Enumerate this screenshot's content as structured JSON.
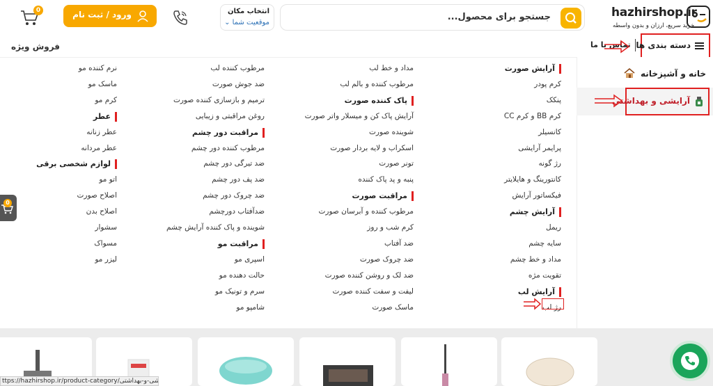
{
  "header": {
    "logo_main": "hazhirshop.ir",
    "logo_tagline": "خرید سریع، ارزان و بدون واسطه",
    "search_placeholder": "جستجو برای محصول...",
    "location_title": "انتخاب مکان",
    "location_value": "موقعیت شما",
    "login_label": "ورود / ثبت نام",
    "cart_count": "0"
  },
  "nav": {
    "categories_label": "دسته بندی ها",
    "contact_label": "تماس با ما",
    "special_sale_label": "فروش ویژه"
  },
  "categories": [
    {
      "label": "خانه و آشپزخانه"
    },
    {
      "label": "آرایشی و بهداشتی"
    }
  ],
  "megamenu": {
    "col1": [
      {
        "t": "h",
        "label": "آرایش صورت"
      },
      {
        "t": "i",
        "label": "کرم پودر"
      },
      {
        "t": "i",
        "label": "پنکک"
      },
      {
        "t": "i",
        "label": "کرم BB و کرم CC"
      },
      {
        "t": "i",
        "label": "کانسیلر"
      },
      {
        "t": "i",
        "label": "پرایمر آرایشی"
      },
      {
        "t": "i",
        "label": "رژ گونه"
      },
      {
        "t": "i",
        "label": "کانتورینگ و هایلایتر"
      },
      {
        "t": "i",
        "label": "فیکساتور آرایش"
      },
      {
        "t": "h",
        "label": "آرایش چشم"
      },
      {
        "t": "i",
        "label": "ریمل"
      },
      {
        "t": "i",
        "label": "سایه چشم"
      },
      {
        "t": "i",
        "label": "مداد و خط چشم"
      },
      {
        "t": "i",
        "label": "تقویت مژه"
      },
      {
        "t": "h",
        "label": "آرایش لب"
      },
      {
        "t": "i",
        "label": "رژ لب"
      }
    ],
    "col2": [
      {
        "t": "i",
        "label": "مداد و خط لب"
      },
      {
        "t": "i",
        "label": "مرطوب کننده و بالم لب"
      },
      {
        "t": "h",
        "label": "پاک کننده صورت"
      },
      {
        "t": "i",
        "label": "آرایش پاک کن و میسلار واتر صورت"
      },
      {
        "t": "i",
        "label": "شوینده صورت"
      },
      {
        "t": "i",
        "label": "اسکراب و لایه بردار صورت"
      },
      {
        "t": "i",
        "label": "تونر صورت"
      },
      {
        "t": "i",
        "label": "پنبه و پد پاک کننده"
      },
      {
        "t": "h",
        "label": "مراقبت صورت"
      },
      {
        "t": "i",
        "label": "مرطوب کننده و آبرسان صورت"
      },
      {
        "t": "i",
        "label": "کرم شب و روز"
      },
      {
        "t": "i",
        "label": "ضد آفتاب"
      },
      {
        "t": "i",
        "label": "ضد چروک صورت"
      },
      {
        "t": "i",
        "label": "ضد لک و روشن کننده صورت"
      },
      {
        "t": "i",
        "label": "لیفت و سفت کننده صورت"
      },
      {
        "t": "i",
        "label": "ماسک صورت"
      }
    ],
    "col3": [
      {
        "t": "i",
        "label": "مرطوب کننده لب"
      },
      {
        "t": "i",
        "label": "ضد جوش صورت"
      },
      {
        "t": "i",
        "label": "ترمیم و بازسازی کننده صورت"
      },
      {
        "t": "i",
        "label": "روغن مراقبتی و زیبایی"
      },
      {
        "t": "h",
        "label": "مراقبت دور چشم"
      },
      {
        "t": "i",
        "label": "مرطوب کننده دور چشم"
      },
      {
        "t": "i",
        "label": "ضد تیرگی دور چشم"
      },
      {
        "t": "i",
        "label": "ضد پف دور چشم"
      },
      {
        "t": "i",
        "label": "ضد چروک دور چشم"
      },
      {
        "t": "i",
        "label": "ضدآفتاب دورچشم"
      },
      {
        "t": "i",
        "label": "شوینده و پاک کننده آرایش چشم"
      },
      {
        "t": "h",
        "label": "مراقبت مو"
      },
      {
        "t": "i",
        "label": "اسپری مو"
      },
      {
        "t": "i",
        "label": "حالت دهنده مو"
      },
      {
        "t": "i",
        "label": "سرم و تونیک مو"
      },
      {
        "t": "i",
        "label": "شامپو مو"
      }
    ],
    "col4": [
      {
        "t": "i",
        "label": "نرم کننده مو"
      },
      {
        "t": "i",
        "label": "ماسک مو"
      },
      {
        "t": "i",
        "label": "کرم مو"
      },
      {
        "t": "h",
        "label": "عطر"
      },
      {
        "t": "i",
        "label": "عطر زنانه"
      },
      {
        "t": "i",
        "label": "عطر مردانه"
      },
      {
        "t": "h",
        "label": "لوازم شخصی برقی"
      },
      {
        "t": "i",
        "label": "اتو مو"
      },
      {
        "t": "i",
        "label": "اصلاح صورت"
      },
      {
        "t": "i",
        "label": "اصلاح بدن"
      },
      {
        "t": "i",
        "label": "سشوار"
      },
      {
        "t": "i",
        "label": "مسواک"
      },
      {
        "t": "i",
        "label": "لیزر مو"
      }
    ]
  },
  "status_bar": "ttps://hazhirshop.ir/product-category/آرایشی-و-بهداشتی/",
  "side_cart_count": "0",
  "colors": {
    "accent": "#f8a800",
    "highlight": "#e02020",
    "whatsapp": "#1aa55a"
  }
}
